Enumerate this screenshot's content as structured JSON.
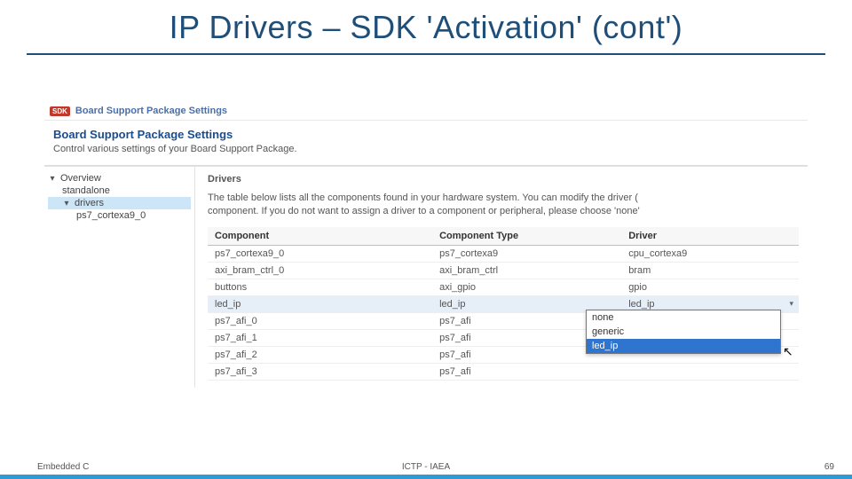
{
  "slide": {
    "title": "IP Drivers – SDK 'Activation' (cont')"
  },
  "window": {
    "app_badge": "SDK",
    "title": "Board Support Package Settings"
  },
  "header": {
    "heading": "Board Support Package Settings",
    "sub": "Control various settings of your Board Support Package."
  },
  "tree": {
    "root": "Overview",
    "items": [
      "standalone",
      "drivers",
      "ps7_cortexa9_0"
    ],
    "selected": "drivers"
  },
  "panel": {
    "title": "Drivers",
    "desc_line1": "The table below lists all the components found in your hardware system. You can modify the driver (",
    "desc_line2": "component. If you do not want to assign a driver to a component or peripheral, please choose 'none'"
  },
  "table": {
    "cols": [
      "Component",
      "Component Type",
      "Driver"
    ],
    "rows": [
      {
        "c": "ps7_cortexa9_0",
        "t": "ps7_cortexa9",
        "d": "cpu_cortexa9"
      },
      {
        "c": "axi_bram_ctrl_0",
        "t": "axi_bram_ctrl",
        "d": "bram"
      },
      {
        "c": "buttons",
        "t": "axi_gpio",
        "d": "gpio"
      },
      {
        "c": "led_ip",
        "t": "led_ip",
        "d": "led_ip",
        "selected": true,
        "combo": true
      },
      {
        "c": "ps7_afi_0",
        "t": "ps7_afi",
        "d": ""
      },
      {
        "c": "ps7_afi_1",
        "t": "ps7_afi",
        "d": ""
      },
      {
        "c": "ps7_afi_2",
        "t": "ps7_afi",
        "d": ""
      },
      {
        "c": "ps7_afi_3",
        "t": "ps7_afi",
        "d": ""
      }
    ]
  },
  "dropdown": {
    "options": [
      "none",
      "generic",
      "led_ip"
    ],
    "selected": "led_ip"
  },
  "footer": {
    "left": "Embedded C",
    "center": "ICTP - IAEA",
    "right": "69"
  }
}
